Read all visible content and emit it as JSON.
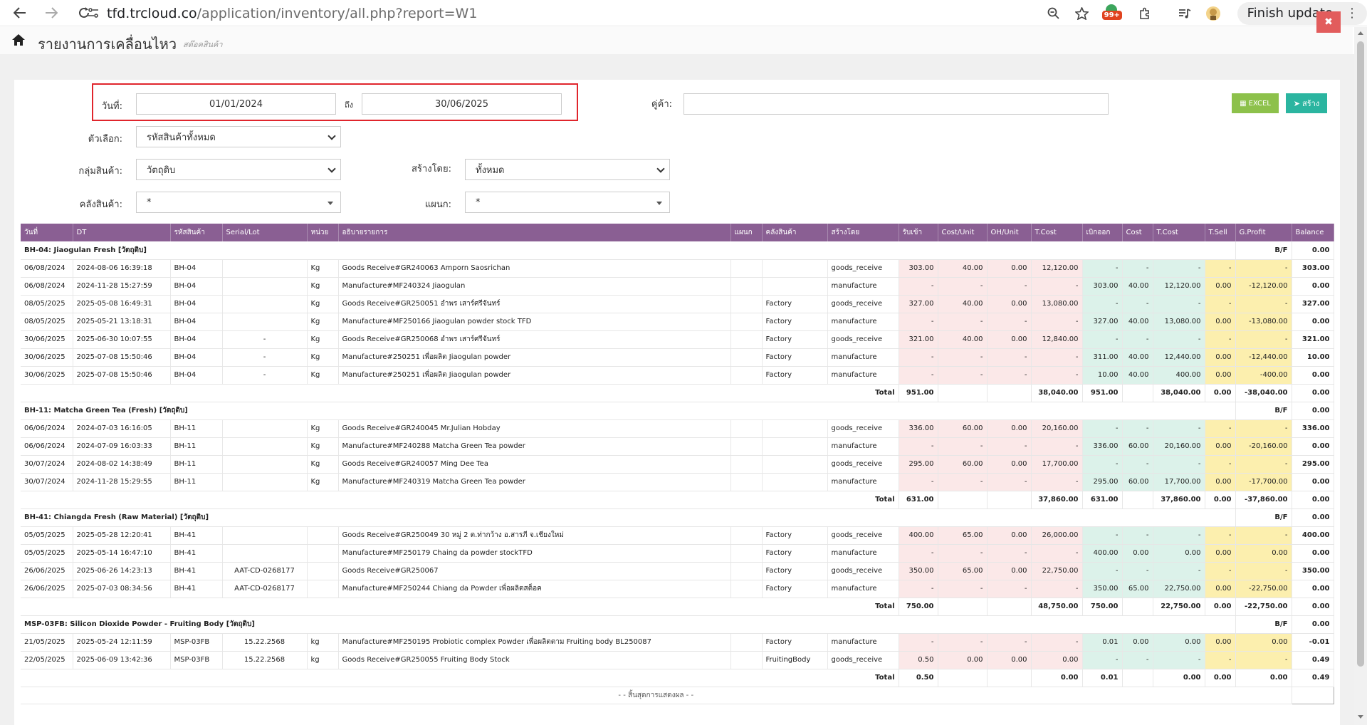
{
  "browser": {
    "url_host": "tfd.trcloud.co",
    "url_path": "/application/inventory/all.php?report=W1",
    "extension_badge": "99+",
    "finish_update": "Finish update"
  },
  "header": {
    "title": "รายงานการเคลื่อนไหว",
    "subtitle": "สต๊อคสินค้า",
    "close_label": "✖"
  },
  "filters": {
    "date_label": "วันที่:",
    "date_from": "01/01/2024",
    "to_label": "ถึง",
    "date_to": "30/06/2025",
    "customer_label": "คู่ค้า:",
    "customer_value": "",
    "option_label": "ตัวเลือก:",
    "option_value": "รหัสสินค้าทั้งหมด",
    "group_label": "กลุ่มสินค้า:",
    "group_value": "วัตถุดิบ",
    "createdby_label": "สร้างโดย:",
    "createdby_value": "ทั้งหมด",
    "warehouse_label": "คลังสินค้า:",
    "warehouse_value": "*",
    "dept_label": "แผนก:",
    "dept_value": "*",
    "excel_label": "EXCEL",
    "create_label": "สร้าง"
  },
  "table": {
    "headers": [
      "วันที่",
      "DT",
      "รหัสสินค้า",
      "Serial/Lot",
      "หน่วย",
      "อธิบายรายการ",
      "แผนก",
      "คลังสินค้า",
      "สร้างโดย",
      "รับเข้า",
      "Cost/Unit",
      "OH/Unit",
      "T.Cost",
      "เบิกออก",
      "Cost",
      "T.Cost",
      "T.Sell",
      "G.Profit",
      "Balance"
    ],
    "groups": [
      {
        "title": "BH-04: Jiaogulan Fresh [วัตถุดิบ]",
        "bf_label": "B/F",
        "bf_value": "0.00",
        "rows": [
          [
            "06/08/2024",
            "2024-08-06 16:39:18",
            "BH-04",
            "",
            "Kg",
            "Goods Receive#GR240063 Amporn Saosrichan",
            "",
            "",
            "goods_receive",
            "303.00",
            "40.00",
            "0.00",
            "12,120.00",
            "-",
            "-",
            "-",
            "-",
            "-",
            "303.00"
          ],
          [
            "06/08/2024",
            "2024-11-28 15:27:59",
            "BH-04",
            "",
            "Kg",
            "Manufacture#MF240324 Jiaogulan",
            "",
            "",
            "manufacture",
            "-",
            "-",
            "-",
            "-",
            "303.00",
            "40.00",
            "12,120.00",
            "0.00",
            "-12,120.00",
            "0.00"
          ],
          [
            "08/05/2025",
            "2025-05-08 16:49:31",
            "BH-04",
            "",
            "Kg",
            "Goods Receive#GR250051 อำพร เสาร์ศรีจันทร์",
            "",
            "Factory",
            "goods_receive",
            "327.00",
            "40.00",
            "0.00",
            "13,080.00",
            "-",
            "-",
            "-",
            "-",
            "-",
            "327.00"
          ],
          [
            "08/05/2025",
            "2025-05-21 13:18:31",
            "BH-04",
            "",
            "Kg",
            "Manufacture#MF250166 Jiaogulan powder stock TFD",
            "",
            "Factory",
            "manufacture",
            "-",
            "-",
            "-",
            "-",
            "327.00",
            "40.00",
            "13,080.00",
            "0.00",
            "-13,080.00",
            "0.00"
          ],
          [
            "30/06/2025",
            "2025-06-30 10:07:55",
            "BH-04",
            "-",
            "Kg",
            "Goods Receive#GR250068 อำพร เสาร์ศรีจันทร์",
            "",
            "Factory",
            "goods_receive",
            "321.00",
            "40.00",
            "0.00",
            "12,840.00",
            "-",
            "-",
            "-",
            "-",
            "-",
            "321.00"
          ],
          [
            "30/06/2025",
            "2025-07-08 15:50:46",
            "BH-04",
            "-",
            "Kg",
            "Manufacture#250251 เพื่อผลิต Jiaogulan powder",
            "",
            "Factory",
            "manufacture",
            "-",
            "-",
            "-",
            "-",
            "311.00",
            "40.00",
            "12,440.00",
            "0.00",
            "-12,440.00",
            "10.00"
          ],
          [
            "30/06/2025",
            "2025-07-08 15:50:46",
            "BH-04",
            "-",
            "Kg",
            "Manufacture#250251 เพื่อผลิต Jiaogulan powder",
            "",
            "Factory",
            "manufacture",
            "-",
            "-",
            "-",
            "-",
            "10.00",
            "40.00",
            "400.00",
            "0.00",
            "-400.00",
            "0.00"
          ]
        ],
        "total": [
          "Total",
          "951.00",
          "",
          "",
          "38,040.00",
          "951.00",
          "",
          "38,040.00",
          "0.00",
          "-38,040.00",
          "0.00"
        ]
      },
      {
        "title": "BH-11: Matcha Green Tea (Fresh) [วัตถุดิบ]",
        "bf_label": "B/F",
        "bf_value": "0.00",
        "rows": [
          [
            "06/06/2024",
            "2024-07-03 16:16:05",
            "BH-11",
            "",
            "Kg",
            "Goods Receive#GR240045 Mr.Julian Hobday",
            "",
            "",
            "goods_receive",
            "336.00",
            "60.00",
            "0.00",
            "20,160.00",
            "-",
            "-",
            "-",
            "-",
            "-",
            "336.00"
          ],
          [
            "06/06/2024",
            "2024-07-09 16:03:33",
            "BH-11",
            "",
            "Kg",
            "Manufacture#MF240288 Matcha Green Tea powder",
            "",
            "",
            "manufacture",
            "-",
            "-",
            "-",
            "-",
            "336.00",
            "60.00",
            "20,160.00",
            "0.00",
            "-20,160.00",
            "0.00"
          ],
          [
            "30/07/2024",
            "2024-08-02 14:38:49",
            "BH-11",
            "",
            "Kg",
            "Goods Receive#GR240057 Ming Dee Tea",
            "",
            "",
            "goods_receive",
            "295.00",
            "60.00",
            "0.00",
            "17,700.00",
            "-",
            "-",
            "-",
            "-",
            "-",
            "295.00"
          ],
          [
            "30/07/2024",
            "2024-11-28 15:29:55",
            "BH-11",
            "",
            "Kg",
            "Manufacture#MF240319 Matcha Green Tea powder",
            "",
            "",
            "manufacture",
            "-",
            "-",
            "-",
            "-",
            "295.00",
            "60.00",
            "17,700.00",
            "0.00",
            "-17,700.00",
            "0.00"
          ]
        ],
        "total": [
          "Total",
          "631.00",
          "",
          "",
          "37,860.00",
          "631.00",
          "",
          "37,860.00",
          "0.00",
          "-37,860.00",
          "0.00"
        ]
      },
      {
        "title": "BH-41: Chiangda Fresh (Raw Material) [วัตถุดิบ]",
        "bf_label": "B/F",
        "bf_value": "0.00",
        "rows": [
          [
            "05/05/2025",
            "2025-05-28 12:20:41",
            "BH-41",
            "",
            "",
            "Goods Receive#GR250049 30 หมู่ 2 ต.ท่ากว้าง อ.สารภี จ.เชียงใหม่",
            "",
            "Factory",
            "goods_receive",
            "400.00",
            "65.00",
            "0.00",
            "26,000.00",
            "-",
            "-",
            "-",
            "-",
            "-",
            "400.00"
          ],
          [
            "05/05/2025",
            "2025-05-14 16:47:10",
            "BH-41",
            "",
            "",
            "Manufacture#MF250179 Chaing da powder stockTFD",
            "",
            "Factory",
            "manufacture",
            "-",
            "-",
            "-",
            "-",
            "400.00",
            "0.00",
            "0.00",
            "0.00",
            "0.00",
            "0.00"
          ],
          [
            "26/06/2025",
            "2025-06-26 14:23:13",
            "BH-41",
            "AAT-CD-0268177",
            "",
            "Goods Receive#GR250067",
            "",
            "Factory",
            "goods_receive",
            "350.00",
            "65.00",
            "0.00",
            "22,750.00",
            "-",
            "-",
            "-",
            "-",
            "-",
            "350.00"
          ],
          [
            "26/06/2025",
            "2025-07-03 08:34:56",
            "BH-41",
            "AAT-CD-0268177",
            "",
            "Manufacture#MF250244 Chiang da Powder เพื่อผลิตสต็อค",
            "",
            "Factory",
            "manufacture",
            "-",
            "-",
            "-",
            "-",
            "350.00",
            "65.00",
            "22,750.00",
            "0.00",
            "-22,750.00",
            "0.00"
          ]
        ],
        "total": [
          "Total",
          "750.00",
          "",
          "",
          "48,750.00",
          "750.00",
          "",
          "22,750.00",
          "0.00",
          "-22,750.00",
          "0.00"
        ]
      },
      {
        "title": "MSP-03FB: Silicon Dioxide Powder - Fruiting Body [วัตถุดิบ]",
        "bf_label": "B/F",
        "bf_value": "0.00",
        "rows": [
          [
            "21/05/2025",
            "2025-05-24 12:11:59",
            "MSP-03FB",
            "15.22.2568",
            "kg",
            "Manufacture#MF250195 Probiotic complex Powder เพื่อผลิตตาม Fruiting body BL250087",
            "",
            "Factory",
            "manufacture",
            "-",
            "-",
            "-",
            "-",
            "0.01",
            "0.00",
            "0.00",
            "0.00",
            "0.00",
            "-0.01"
          ],
          [
            "22/05/2025",
            "2025-06-09 13:42:36",
            "MSP-03FB",
            "15.22.2568",
            "kg",
            "Goods Receive#GR250055 Fruiting Body Stock",
            "",
            "FruitingBody",
            "goods_receive",
            "0.50",
            "0.00",
            "0.00",
            "0.00",
            "-",
            "-",
            "-",
            "-",
            "-",
            "0.49"
          ]
        ],
        "total": [
          "Total",
          "0.50",
          "",
          "",
          "0.00",
          "0.01",
          "",
          "0.00",
          "0.00",
          "0.00",
          "0.49"
        ]
      }
    ],
    "end_text": "- - สิ้นสุดการแสดงผล - -"
  }
}
